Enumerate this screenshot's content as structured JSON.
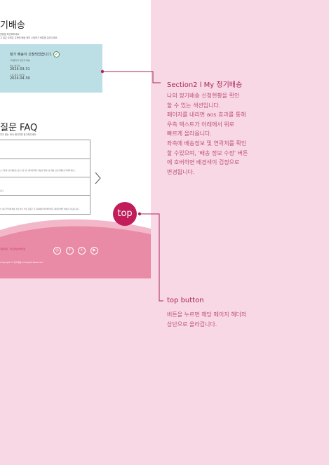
{
  "mockup": {
    "subscription": {
      "title": "기배송",
      "subtitle_1": "현황을 확인해보세요.",
      "subtitle_2": "고 싶은 요청은 우측에 배송 정보 수정하기 버튼을 눌러주세요.",
      "message": "정기 배송이 신청되었습니다.",
      "check_icon": "check-circle-icon",
      "note": "3개월마다 한번씩 배송",
      "delivery_label": "발송 예정일",
      "delivery_date": "2024.03.31",
      "arrival_label": "수령 예정 예정일",
      "arrival_date": "2024.04.30"
    },
    "faq": {
      "title": "질문 FAQ",
      "subtitle": "자주 묻는 FAQ 페이지를 참고해주세요",
      "items": [
        "",
        "소 주문하시면 배송받으실 수 있나요 (최대한 빠른 배송을 원하시면 배송 담당자에게 문의해주세요.)",
        "니다.",
        "보 상단 우측에 배송 수정 정보 수정, 상품은 각 회사에서 확인해주세요 (최대한 빠른 배송이 가능합니다.)"
      ],
      "arrow_icon": "chevron-right-icon"
    },
    "footer": {
      "link": "이용약관 · 개인정보처리방침",
      "copyright": "Copyright © 정기배송 All Rights Reserved.",
      "social_icons": [
        "instagram-icon",
        "facebook-icon",
        "twitter-icon",
        "youtube-icon"
      ]
    }
  },
  "top_button": {
    "label": "top"
  },
  "annotations": [
    {
      "title": "Section2 l My 정기배송",
      "lines": [
        "나의 정기배송 신청현황을 확인",
        "할 수 있는 섹션입니다.",
        "페이지를 내리면 aos 효과를 통해",
        "우측 텍스트가 아래에서 위로",
        "빠르게 올라옵니다.",
        "좌측에 배송정보 및 연락처를 확인",
        "할 수있으며, '배송 정보 수정' 버튼",
        "에 호버하면 배경색이 검정으로",
        "변경됩니다."
      ]
    },
    {
      "title": "top button",
      "lines": [
        "버튼을 누르면 해당 페이지 헤더의",
        "상단으로 올라갑니다."
      ]
    }
  ],
  "colors": {
    "background": "#f8d8e4",
    "accent": "#c01d5a",
    "card": "#bcdfe5",
    "footer": "#e98aa6",
    "annotation_text": "#bd4f7d"
  }
}
